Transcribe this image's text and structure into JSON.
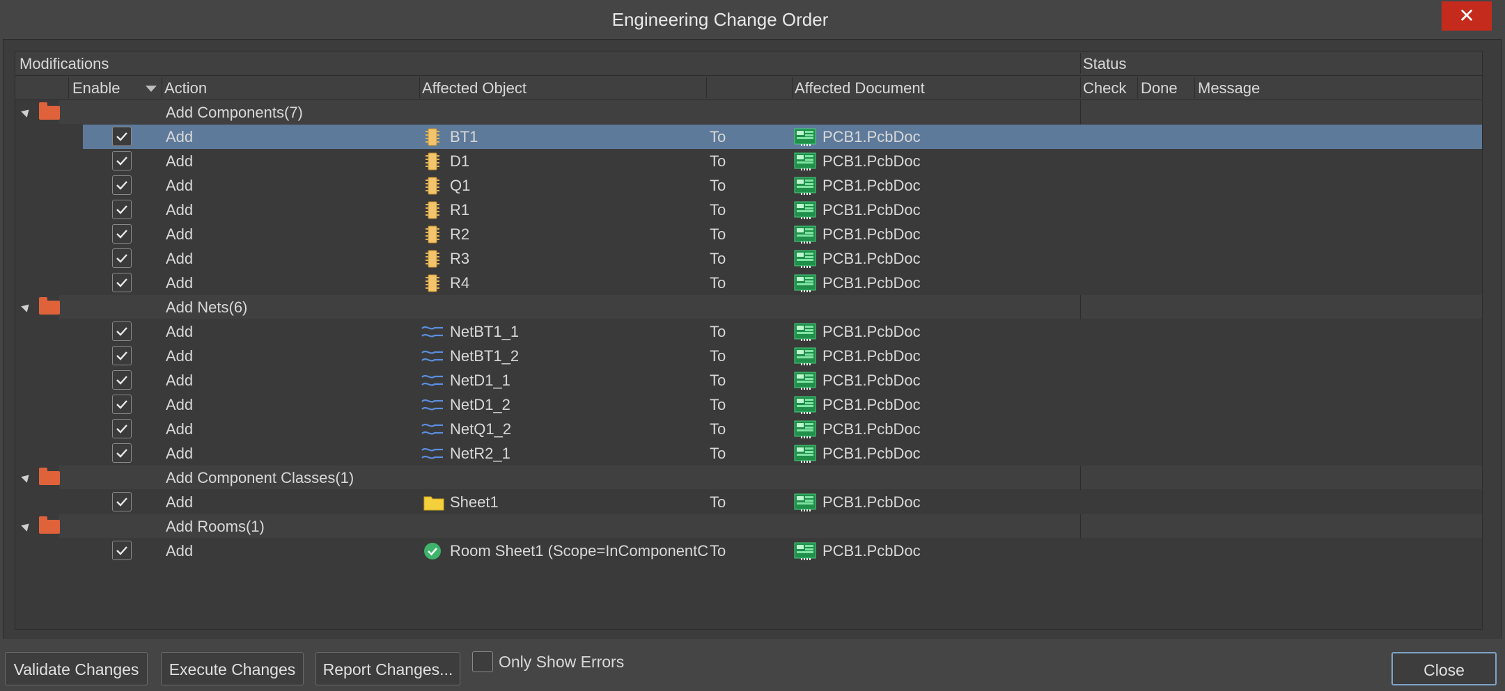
{
  "window": {
    "title": "Engineering Change Order",
    "close_glyph": "✕"
  },
  "header": {
    "modifications": "Modifications",
    "status": "Status",
    "enable": "Enable",
    "action": "Action",
    "affected_object": "Affected Object",
    "affected_document": "Affected Document",
    "check": "Check",
    "done": "Done",
    "message": "Message"
  },
  "groups": [
    {
      "label": "Add Components(7)",
      "items": [
        {
          "action": "Add",
          "object": "BT1",
          "to": "To",
          "document": "PCB1.PcbDoc",
          "icon": "component-icon",
          "selected": true
        },
        {
          "action": "Add",
          "object": "D1",
          "to": "To",
          "document": "PCB1.PcbDoc",
          "icon": "component-icon"
        },
        {
          "action": "Add",
          "object": "Q1",
          "to": "To",
          "document": "PCB1.PcbDoc",
          "icon": "component-icon"
        },
        {
          "action": "Add",
          "object": "R1",
          "to": "To",
          "document": "PCB1.PcbDoc",
          "icon": "component-icon"
        },
        {
          "action": "Add",
          "object": "R2",
          "to": "To",
          "document": "PCB1.PcbDoc",
          "icon": "component-icon"
        },
        {
          "action": "Add",
          "object": "R3",
          "to": "To",
          "document": "PCB1.PcbDoc",
          "icon": "component-icon"
        },
        {
          "action": "Add",
          "object": "R4",
          "to": "To",
          "document": "PCB1.PcbDoc",
          "icon": "component-icon"
        }
      ]
    },
    {
      "label": "Add Nets(6)",
      "items": [
        {
          "action": "Add",
          "object": "NetBT1_1",
          "to": "To",
          "document": "PCB1.PcbDoc",
          "icon": "net-icon"
        },
        {
          "action": "Add",
          "object": "NetBT1_2",
          "to": "To",
          "document": "PCB1.PcbDoc",
          "icon": "net-icon"
        },
        {
          "action": "Add",
          "object": "NetD1_1",
          "to": "To",
          "document": "PCB1.PcbDoc",
          "icon": "net-icon"
        },
        {
          "action": "Add",
          "object": "NetD1_2",
          "to": "To",
          "document": "PCB1.PcbDoc",
          "icon": "net-icon"
        },
        {
          "action": "Add",
          "object": "NetQ1_2",
          "to": "To",
          "document": "PCB1.PcbDoc",
          "icon": "net-icon"
        },
        {
          "action": "Add",
          "object": "NetR2_1",
          "to": "To",
          "document": "PCB1.PcbDoc",
          "icon": "net-icon"
        }
      ]
    },
    {
      "label": "Add Component Classes(1)",
      "items": [
        {
          "action": "Add",
          "object": "Sheet1",
          "to": "To",
          "document": "PCB1.PcbDoc",
          "icon": "folder-icon"
        }
      ]
    },
    {
      "label": "Add Rooms(1)",
      "items": [
        {
          "action": "Add",
          "object": "Room Sheet1 (Scope=InComponentC",
          "to": "To",
          "document": "PCB1.PcbDoc",
          "icon": "room-check-icon"
        }
      ]
    }
  ],
  "footer": {
    "validate": "Validate Changes",
    "execute": "Execute Changes",
    "report": "Report Changes...",
    "only_errors": "Only Show Errors",
    "close": "Close"
  },
  "colors": {
    "background": "#454545",
    "selection": "#5e7a9a",
    "close_button": "#c42b1c",
    "folder": "#e0623b",
    "default_button_border": "#7ea4c8"
  }
}
